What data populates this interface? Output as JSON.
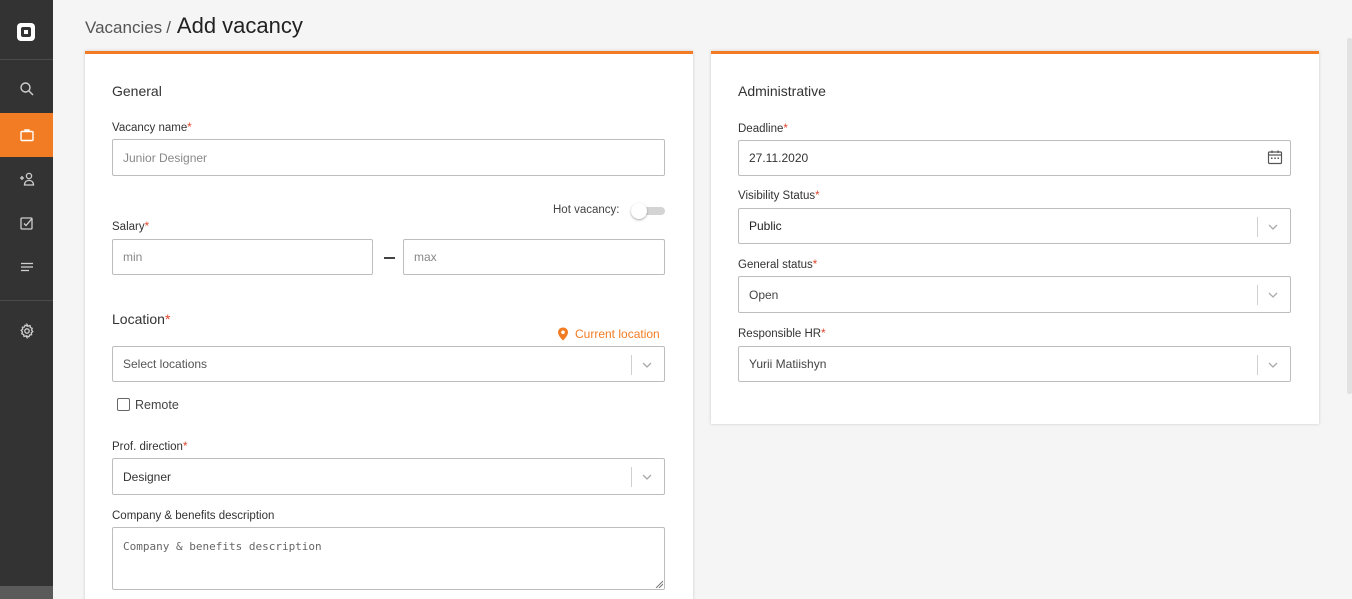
{
  "nav": {
    "items": [
      {
        "icon": "search-icon"
      },
      {
        "icon": "briefcase-icon",
        "active": true
      },
      {
        "icon": "add-user-icon"
      },
      {
        "icon": "checklist-icon"
      },
      {
        "icon": "list-icon"
      },
      {
        "icon": "gear-icon"
      }
    ],
    "accent": "#f27c23"
  },
  "header": {
    "breadcrumb_parent": "Vacancies",
    "separator": "/",
    "title": "Add vacancy"
  },
  "general": {
    "title": "General",
    "vacancy_name_label": "Vacancy name",
    "vacancy_name_placeholder": "Junior Designer",
    "hot_vacancy_label": "Hot vacancy:",
    "hot_vacancy_on": false,
    "salary_label": "Salary",
    "salary_min_placeholder": "min",
    "salary_max_placeholder": "max",
    "location_label": "Location",
    "current_location": "Current location",
    "location_placeholder": "Select locations",
    "remote_label": "Remote",
    "remote_checked": false,
    "prof_direction_label": "Prof. direction",
    "prof_direction_value": "Designer",
    "company_label": "Company & benefits description",
    "company_placeholder": "Company & benefits description",
    "required_mark": "*"
  },
  "administrative": {
    "title": "Administrative",
    "deadline_label": "Deadline",
    "deadline_value": "27.11.2020",
    "visibility_label": "Visibility Status",
    "visibility_value": "Public",
    "general_status_label": "General status",
    "general_status_value": "Open",
    "responsible_hr_label": "Responsible HR",
    "responsible_hr_value": "Yurii Matiishyn",
    "required_mark": "*"
  }
}
